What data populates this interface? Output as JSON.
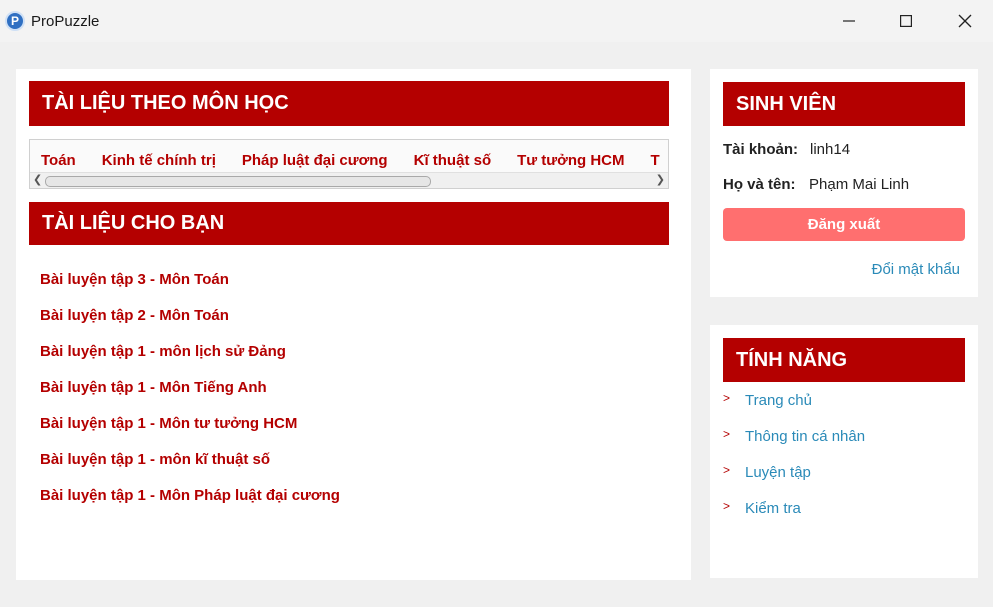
{
  "window": {
    "icon_letter": "P",
    "title": "ProPuzzle",
    "controls": [
      "minimize-icon",
      "maximize-icon",
      "close-icon"
    ]
  },
  "subjects_section": {
    "title": "TÀI LIỆU THEO MÔN HỌC",
    "subjects": [
      "Toán",
      "Kinh tế chính trị",
      "Pháp luật đại cương",
      "Kĩ thuật số",
      "Tư tưởng HCM",
      "T"
    ]
  },
  "for_you_section": {
    "title": "TÀI LIỆU CHO BẠN",
    "documents": [
      "Bài luyện tập 3 - Môn Toán",
      "Bài luyện tập 2 - Môn Toán",
      "Bài luyện tập 1 - môn lịch sử Đảng",
      "Bài luyện tập 1 - Môn Tiếng Anh",
      "Bài luyện tập 1 - Môn tư tưởng HCM",
      "Bài luyện tập 1 - môn kĩ thuật số",
      "Bài luyện tập 1 - Môn Pháp luật đại cương"
    ]
  },
  "student": {
    "title": "SINH VIÊN",
    "account_label": "Tài khoản:",
    "account_value": "linh14",
    "name_label": "Họ và tên:",
    "name_value": "Phạm Mai Linh",
    "logout_label": "Đăng xuất",
    "change_password_label": "Đổi mật khẩu"
  },
  "features": {
    "title": "TÍNH NĂNG",
    "items": [
      "Trang chủ",
      "Thông tin cá nhân",
      "Luyện tập",
      "Kiểm tra"
    ]
  },
  "colors": {
    "brand_red": "#b40000",
    "logout_button": "#ff6f6f",
    "link_blue": "#2a8ab8",
    "background": "#f0f0f0"
  }
}
